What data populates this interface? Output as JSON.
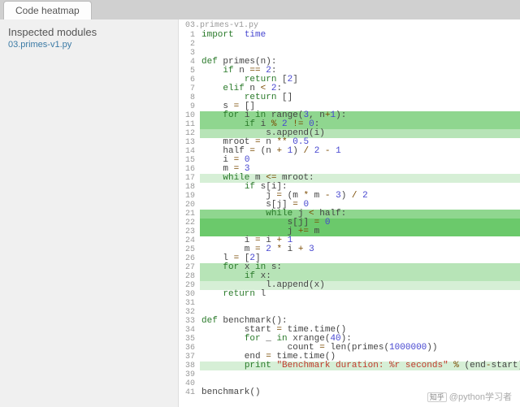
{
  "tab": {
    "label": "Code heatmap"
  },
  "sidebar": {
    "title": "Inspected modules",
    "modules": [
      {
        "label": "03.primes-v1.py"
      }
    ]
  },
  "editor": {
    "filename": "03.primes-v1.py",
    "lines": [
      {
        "n": 1,
        "heat": 0,
        "tokens": [
          [
            "kw",
            "import"
          ],
          [
            "",
            "  "
          ],
          [
            "imp",
            "time"
          ]
        ]
      },
      {
        "n": 2,
        "heat": 0,
        "tokens": []
      },
      {
        "n": 3,
        "heat": 0,
        "tokens": []
      },
      {
        "n": 4,
        "heat": 0,
        "tokens": [
          [
            "py-def",
            "def"
          ],
          [
            "",
            " primes(n):"
          ]
        ]
      },
      {
        "n": 5,
        "heat": 0,
        "tokens": [
          [
            "",
            "    "
          ],
          [
            "kw",
            "if"
          ],
          [
            "",
            " n "
          ],
          [
            "op",
            "=="
          ],
          [
            "",
            " "
          ],
          [
            "num",
            "2"
          ],
          [
            "",
            ":"
          ]
        ]
      },
      {
        "n": 6,
        "heat": 0,
        "tokens": [
          [
            "",
            "        "
          ],
          [
            "kw",
            "return"
          ],
          [
            "",
            " ["
          ],
          [
            "num",
            "2"
          ],
          [
            "",
            "]"
          ]
        ]
      },
      {
        "n": 7,
        "heat": 0,
        "tokens": [
          [
            "",
            "    "
          ],
          [
            "kw",
            "elif"
          ],
          [
            "",
            " n "
          ],
          [
            "op",
            "<"
          ],
          [
            "",
            " "
          ],
          [
            "num",
            "2"
          ],
          [
            "",
            ":"
          ]
        ]
      },
      {
        "n": 8,
        "heat": 0,
        "tokens": [
          [
            "",
            "        "
          ],
          [
            "kw",
            "return"
          ],
          [
            "",
            " []"
          ]
        ]
      },
      {
        "n": 9,
        "heat": 0,
        "tokens": [
          [
            "",
            "    s "
          ],
          [
            "op",
            "="
          ],
          [
            "",
            " []"
          ]
        ]
      },
      {
        "n": 10,
        "heat": 3,
        "tokens": [
          [
            "",
            "    "
          ],
          [
            "kw",
            "for"
          ],
          [
            "",
            " i "
          ],
          [
            "kw",
            "in"
          ],
          [
            "",
            " range("
          ],
          [
            "num",
            "3"
          ],
          [
            "",
            ", n"
          ],
          [
            "op",
            "+"
          ],
          [
            "num",
            "1"
          ],
          [
            "",
            "):"
          ]
        ]
      },
      {
        "n": 11,
        "heat": 3,
        "tokens": [
          [
            "",
            "        "
          ],
          [
            "kw",
            "if"
          ],
          [
            "",
            " i "
          ],
          [
            "op",
            "%"
          ],
          [
            "",
            " "
          ],
          [
            "num",
            "2"
          ],
          [
            "",
            " "
          ],
          [
            "op",
            "!="
          ],
          [
            "",
            " "
          ],
          [
            "num",
            "0"
          ],
          [
            "",
            ":"
          ]
        ]
      },
      {
        "n": 12,
        "heat": 2,
        "tokens": [
          [
            "",
            "            s.append(i)"
          ]
        ]
      },
      {
        "n": 13,
        "heat": 0,
        "tokens": [
          [
            "",
            "    mroot "
          ],
          [
            "op",
            "="
          ],
          [
            "",
            " n "
          ],
          [
            "op",
            "**"
          ],
          [
            "",
            " "
          ],
          [
            "num",
            "0.5"
          ]
        ]
      },
      {
        "n": 14,
        "heat": 0,
        "tokens": [
          [
            "",
            "    half "
          ],
          [
            "op",
            "="
          ],
          [
            "",
            " (n "
          ],
          [
            "op",
            "+"
          ],
          [
            "",
            " "
          ],
          [
            "num",
            "1"
          ],
          [
            "",
            ") "
          ],
          [
            "op",
            "/"
          ],
          [
            "",
            " "
          ],
          [
            "num",
            "2"
          ],
          [
            "",
            " "
          ],
          [
            "op",
            "-"
          ],
          [
            "",
            " "
          ],
          [
            "num",
            "1"
          ]
        ]
      },
      {
        "n": 15,
        "heat": 0,
        "tokens": [
          [
            "",
            "    i "
          ],
          [
            "op",
            "="
          ],
          [
            "",
            " "
          ],
          [
            "num",
            "0"
          ]
        ]
      },
      {
        "n": 16,
        "heat": 0,
        "tokens": [
          [
            "",
            "    m "
          ],
          [
            "op",
            "="
          ],
          [
            "",
            " "
          ],
          [
            "num",
            "3"
          ]
        ]
      },
      {
        "n": 17,
        "heat": 1,
        "tokens": [
          [
            "",
            "    "
          ],
          [
            "kw",
            "while"
          ],
          [
            "",
            " m "
          ],
          [
            "op",
            "<="
          ],
          [
            "",
            " mroot:"
          ]
        ]
      },
      {
        "n": 18,
        "heat": 0,
        "tokens": [
          [
            "",
            "        "
          ],
          [
            "kw",
            "if"
          ],
          [
            "",
            " s[i]:"
          ]
        ]
      },
      {
        "n": 19,
        "heat": 0,
        "tokens": [
          [
            "",
            "            j "
          ],
          [
            "op",
            "="
          ],
          [
            "",
            " (m "
          ],
          [
            "op",
            "*"
          ],
          [
            "",
            " m "
          ],
          [
            "op",
            "-"
          ],
          [
            "",
            " "
          ],
          [
            "num",
            "3"
          ],
          [
            "",
            ") "
          ],
          [
            "op",
            "/"
          ],
          [
            "",
            " "
          ],
          [
            "num",
            "2"
          ]
        ]
      },
      {
        "n": 20,
        "heat": 0,
        "tokens": [
          [
            "",
            "            s[j] "
          ],
          [
            "op",
            "="
          ],
          [
            "",
            " "
          ],
          [
            "num",
            "0"
          ]
        ]
      },
      {
        "n": 21,
        "heat": 3,
        "tokens": [
          [
            "",
            "            "
          ],
          [
            "kw",
            "while"
          ],
          [
            "",
            " j "
          ],
          [
            "op",
            "<"
          ],
          [
            "",
            " half:"
          ]
        ]
      },
      {
        "n": 22,
        "heat": 4,
        "tokens": [
          [
            "",
            "                s[j] "
          ],
          [
            "op",
            "="
          ],
          [
            "",
            " "
          ],
          [
            "num",
            "0"
          ]
        ]
      },
      {
        "n": 23,
        "heat": 4,
        "tokens": [
          [
            "",
            "                j "
          ],
          [
            "op",
            "+="
          ],
          [
            "",
            " m"
          ]
        ]
      },
      {
        "n": 24,
        "heat": 0,
        "tokens": [
          [
            "",
            "        i "
          ],
          [
            "op",
            "="
          ],
          [
            "",
            " i "
          ],
          [
            "op",
            "+"
          ],
          [
            "",
            " "
          ],
          [
            "num",
            "1"
          ]
        ]
      },
      {
        "n": 25,
        "heat": 0,
        "tokens": [
          [
            "",
            "        m "
          ],
          [
            "op",
            "="
          ],
          [
            "",
            " "
          ],
          [
            "num",
            "2"
          ],
          [
            "",
            " "
          ],
          [
            "op",
            "*"
          ],
          [
            "",
            " i "
          ],
          [
            "op",
            "+"
          ],
          [
            "",
            " "
          ],
          [
            "num",
            "3"
          ]
        ]
      },
      {
        "n": 26,
        "heat": 0,
        "tokens": [
          [
            "",
            "    l "
          ],
          [
            "op",
            "="
          ],
          [
            "",
            " ["
          ],
          [
            "num",
            "2"
          ],
          [
            "",
            "]"
          ]
        ]
      },
      {
        "n": 27,
        "heat": 2,
        "tokens": [
          [
            "",
            "    "
          ],
          [
            "kw",
            "for"
          ],
          [
            "",
            " x "
          ],
          [
            "kw",
            "in"
          ],
          [
            "",
            " s:"
          ]
        ]
      },
      {
        "n": 28,
        "heat": 2,
        "tokens": [
          [
            "",
            "        "
          ],
          [
            "kw",
            "if"
          ],
          [
            "",
            " x:"
          ]
        ]
      },
      {
        "n": 29,
        "heat": 1,
        "tokens": [
          [
            "",
            "            l.append(x)"
          ]
        ]
      },
      {
        "n": 30,
        "heat": 0,
        "tokens": [
          [
            "",
            "    "
          ],
          [
            "kw",
            "return"
          ],
          [
            "",
            " l"
          ]
        ]
      },
      {
        "n": 31,
        "heat": 0,
        "tokens": []
      },
      {
        "n": 32,
        "heat": 0,
        "tokens": []
      },
      {
        "n": 33,
        "heat": 0,
        "tokens": [
          [
            "py-def",
            "def"
          ],
          [
            "",
            " benchmark():"
          ]
        ]
      },
      {
        "n": 34,
        "heat": 0,
        "tokens": [
          [
            "",
            "        start "
          ],
          [
            "op",
            "="
          ],
          [
            "",
            " time.time()"
          ]
        ]
      },
      {
        "n": 35,
        "heat": 0,
        "tokens": [
          [
            "",
            "        "
          ],
          [
            "kw",
            "for"
          ],
          [
            "",
            " _ "
          ],
          [
            "kw",
            "in"
          ],
          [
            "",
            " xrange("
          ],
          [
            "num",
            "40"
          ],
          [
            "",
            "):"
          ]
        ]
      },
      {
        "n": 36,
        "heat": 0,
        "tokens": [
          [
            "",
            "                count "
          ],
          [
            "op",
            "="
          ],
          [
            "",
            " len(primes("
          ],
          [
            "num",
            "1000000"
          ],
          [
            "",
            "))"
          ]
        ]
      },
      {
        "n": 37,
        "heat": 0,
        "tokens": [
          [
            "",
            "        end "
          ],
          [
            "op",
            "="
          ],
          [
            "",
            " time.time()"
          ]
        ]
      },
      {
        "n": 38,
        "heat": 1,
        "tokens": [
          [
            "",
            "        "
          ],
          [
            "kw",
            "print"
          ],
          [
            "",
            " "
          ],
          [
            "str",
            "\"Benchmark duration: %r seconds\""
          ],
          [
            "",
            " "
          ],
          [
            "op",
            "%"
          ],
          [
            "",
            " (end"
          ],
          [
            "op",
            "-"
          ],
          [
            "",
            "start)"
          ]
        ]
      },
      {
        "n": 39,
        "heat": 0,
        "tokens": []
      },
      {
        "n": 40,
        "heat": 0,
        "tokens": []
      },
      {
        "n": 41,
        "heat": 0,
        "tokens": [
          [
            "",
            "benchmark()"
          ]
        ]
      }
    ]
  },
  "watermark": {
    "badge": "知乎",
    "handle": "@python学习者"
  }
}
